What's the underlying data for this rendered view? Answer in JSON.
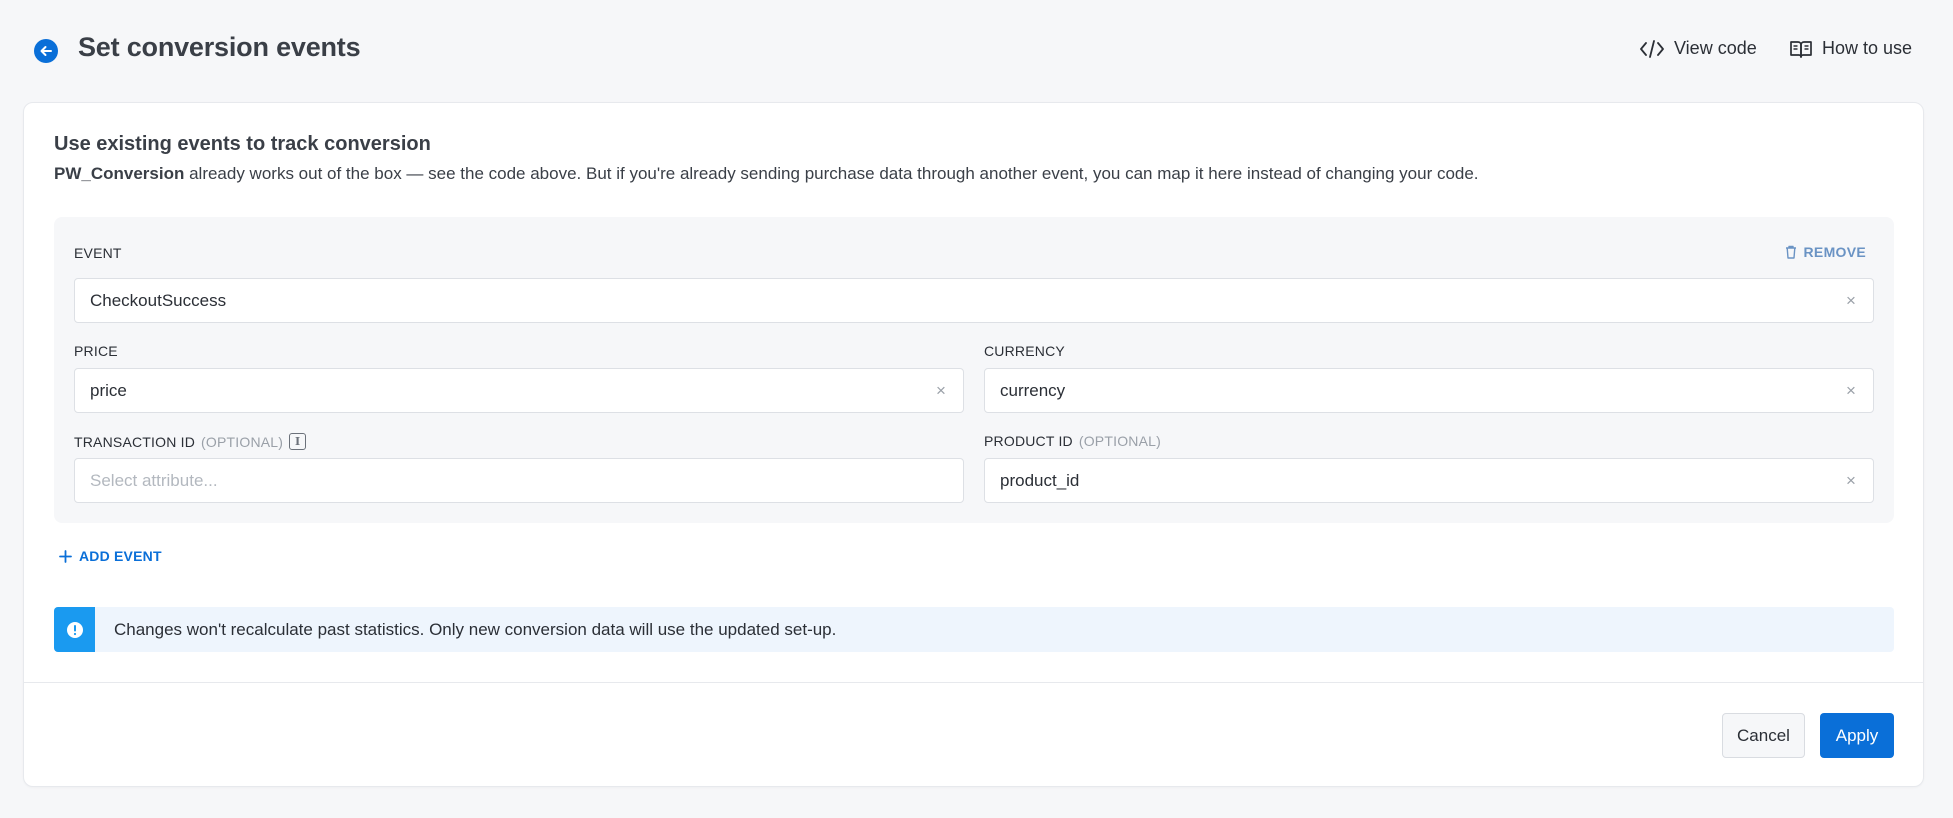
{
  "header": {
    "title": "Set conversion events",
    "view_code_label": "View code",
    "how_to_use_label": "How to use"
  },
  "section": {
    "title": "Use existing events to track conversion",
    "desc_bold": "PW_Conversion",
    "desc_rest": " already works out of the box — see the code above. But if you're already sending purchase data through another event, you can map it here instead of changing your code."
  },
  "event": {
    "remove_label": "REMOVE",
    "event_label": "EVENT",
    "event_value": "CheckoutSuccess",
    "price_label": "PRICE",
    "price_value": "price",
    "currency_label": "CURRENCY",
    "currency_value": "currency",
    "transaction_label": "TRANSACTION ID",
    "transaction_optional": "(OPTIONAL)",
    "transaction_placeholder": "Select attribute...",
    "product_label": "PRODUCT ID",
    "product_optional": "(OPTIONAL)",
    "product_value": "product_id",
    "clear_glyph": "×",
    "info_glyph": "i"
  },
  "add_event_label": "ADD EVENT",
  "notice": {
    "text": "Changes won't recalculate past statistics. Only new conversion data will use the updated set-up."
  },
  "footer": {
    "cancel_label": "Cancel",
    "apply_label": "Apply"
  },
  "colors": {
    "accent": "#0a6fd8",
    "notice_bar": "#1a9af0",
    "notice_bg": "#eef5fd",
    "remove": "#6a93c4"
  }
}
